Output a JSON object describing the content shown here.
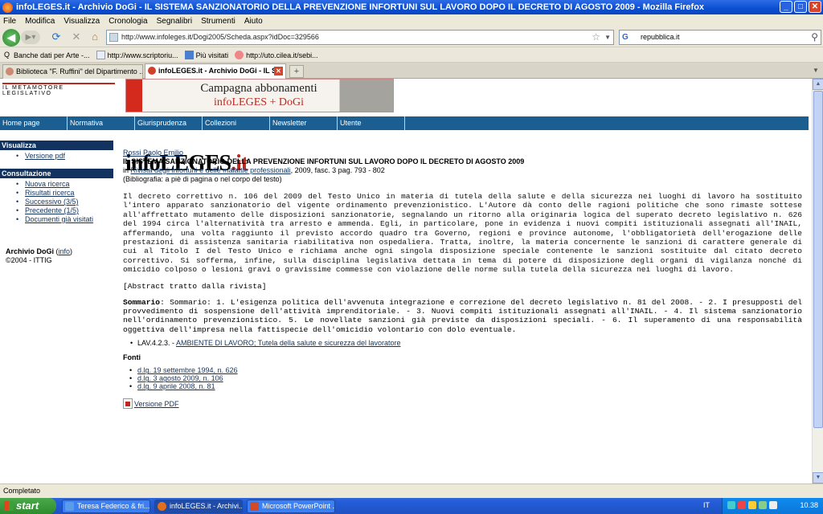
{
  "window": {
    "title": "infoLEGES.it - Archivio DoGi - IL SISTEMA SANZIONATORIO DELLA PREVENZIONE INFORTUNI SUL LAVORO DOPO IL DECRETO DI AGOSTO 2009 - Mozilla Firefox",
    "minimize": "_",
    "maximize": "□",
    "close": "✕"
  },
  "menu": [
    "File",
    "Modifica",
    "Visualizza",
    "Cronologia",
    "Segnalibri",
    "Strumenti",
    "Aiuto"
  ],
  "navbar": {
    "url": "http://www.infoleges.it/Dogi2005/Scheda.aspx?idDoc=329566",
    "search_value": "repubblica.it"
  },
  "bookmarks": [
    "Banche dati per Arte -...",
    "http://www.scriptoriu...",
    "Più visitati",
    "http://uto.cilea.it/sebi..."
  ],
  "tabs": [
    {
      "label": "Biblioteca \"F. Ruffini\" del Dipartimento ..."
    },
    {
      "label": "infoLEGES.it - Archivio DoGi - IL S..."
    }
  ],
  "site": {
    "logo_main_a": "info",
    "logo_main_b": "LEGES",
    "logo_main_c": ".it",
    "logo_sub": "IL METAMOTORE LEGISLATIVO",
    "banner_line1": "Campagna abbonamenti",
    "banner_line2": "infoLEGES + DoGi",
    "topnav": [
      "Home page",
      "Normativa",
      "Giurisprudenza",
      "Collezioni",
      "Newsletter",
      "Utente"
    ]
  },
  "sidebar": {
    "visualizza_head": "Visualizza",
    "visualizza_items": [
      "Versione pdf"
    ],
    "consultazione_head": "Consultazione",
    "consultazione_items": [
      "Nuova ricerca",
      "Risultati ricerca",
      "Successivo (3/5)",
      "Precedente (1/5)",
      "Documenti già visitati"
    ],
    "archivio_label": "Archivio DoGi",
    "archivio_info": "info",
    "copyright": "©2004 - ITTIG"
  },
  "article": {
    "author": "Rossi Paolo Emilio",
    "title": "IL SISTEMA SANZIONATORIO DELLA PREVENZIONE INFORTUNI SUL LAVORO DOPO IL DECRETO DI AGOSTO 2009",
    "cite_prefix": "in",
    "journal": "Rivista degli infortuni e delle malattie professionali",
    "cite_suffix": ", 2009, fasc. 3 pag. 793 - 802",
    "biblio": "(Bibliografia: a piè di pagina o nel corpo del testo)",
    "abstract": "Il decreto correttivo n. 106 del 2009 del Testo Unico in materia di tutela della salute e della sicurezza nei luoghi di lavoro ha sostituito l'intero apparato sanzionatorio del vigente ordinamento prevenzionistico. L'Autore dà conto delle ragioni politiche che sono rimaste sottese all'affrettato mutamento delle disposizioni sanzionatorie, segnalando un ritorno alla originaria logica del superato decreto legislativo n. 626 del 1994 circa l'alternatività tra arresto e ammenda. Egli, in particolare, pone in evidenza i nuovi compiti istituzionali assegnati all'INAIL, affermando, una volta raggiunto il previsto accordo quadro tra Governo, regioni e province autonome, l'obbligatorietà dell'erogazione delle prestazioni di assistenza sanitaria riabilitativa non ospedaliera. Tratta, inoltre, la materia concernente le sanzioni di carattere generale di cui al Titolo I del Testo Unico e richiama anche ogni singola disposizione speciale contenente le sanzioni sostituite dal citato decreto correttivo. Si sofferma, infine, sulla disciplina legislativa dettata in tema di potere di disposizione degli organi di vigilanza nonché di omicidio colposo o lesioni gravi o gravissime commesse con violazione delle norme sulla tutela della sicurezza nei luoghi di lavoro.",
    "abstract_note": "[Abstract tratto dalla rivista]",
    "sommario_label": "Sommario",
    "sommario": ": Sommario: 1. L'esigenza politica dell'avvenuta integrazione e correzione del decreto legislativo n. 81 del 2008. - 2. I presupposti del provvedimento di sospensione dell'attività imprenditoriale. - 3. Nuovi compiti istituzionali assegnati all'INAIL. - 4. Il sistema sanzionatorio nell'ordinamento prevenzionistico. 5. Le novellate sanzioni già previste da disposizioni speciali. - 6. Il superamento di una responsabilità oggettiva dell'impresa nella fattispecie dell'omicidio volontario con dolo eventuale.",
    "subject_code": "LAV.4.2.3. - ",
    "subject_link": "AMBIENTE DI LAVORO; Tutela della salute e sicurezza del lavoratore",
    "fonti_head": "Fonti",
    "fonti": [
      "d.lg. 19 settembre 1994, n. 626",
      "d.lg. 3 agosto 2009, n. 106",
      "d.lg. 9 aprile 2008, n. 81"
    ],
    "pdf_label": "Versione PDF"
  },
  "status": "Completato",
  "taskbar": {
    "start": "start",
    "tasks": [
      "Teresa Federico & fri...",
      "infoLEGES.it - Archivi...",
      "Microsoft PowerPoint ..."
    ],
    "lang": "IT",
    "clock": "10.38"
  }
}
